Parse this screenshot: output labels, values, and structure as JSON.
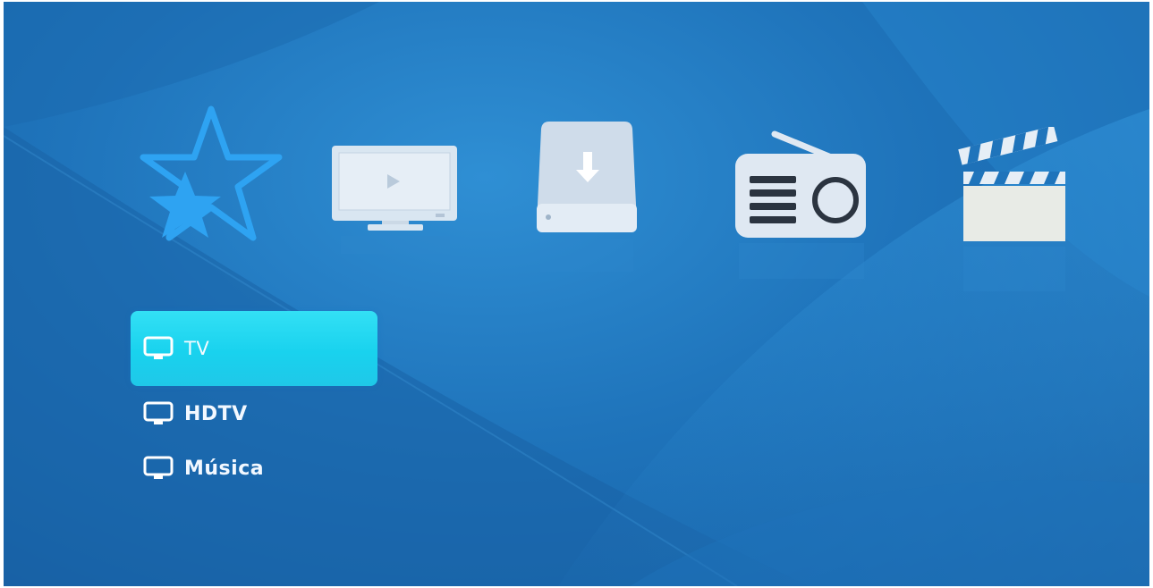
{
  "categories": [
    {
      "name": "favorites",
      "icon": "star-icon",
      "selected": true
    },
    {
      "name": "tv",
      "icon": "tv-monitor-icon",
      "selected": false
    },
    {
      "name": "downloads",
      "icon": "download-drive-icon",
      "selected": false
    },
    {
      "name": "radio",
      "icon": "radio-icon",
      "selected": false
    },
    {
      "name": "movies",
      "icon": "clapperboard-icon",
      "selected": false
    }
  ],
  "menu": {
    "items": [
      {
        "label": "TV",
        "icon": "tv-icon",
        "selected": true
      },
      {
        "label": "HDTV",
        "icon": "tv-icon",
        "selected": false
      },
      {
        "label": "Música",
        "icon": "tv-icon",
        "selected": false
      }
    ]
  },
  "colors": {
    "background": "#1f74bb",
    "selection": "#1fd0ec",
    "icon_fill": "#dfe8f2",
    "star_accent": "#2ea3f2"
  }
}
